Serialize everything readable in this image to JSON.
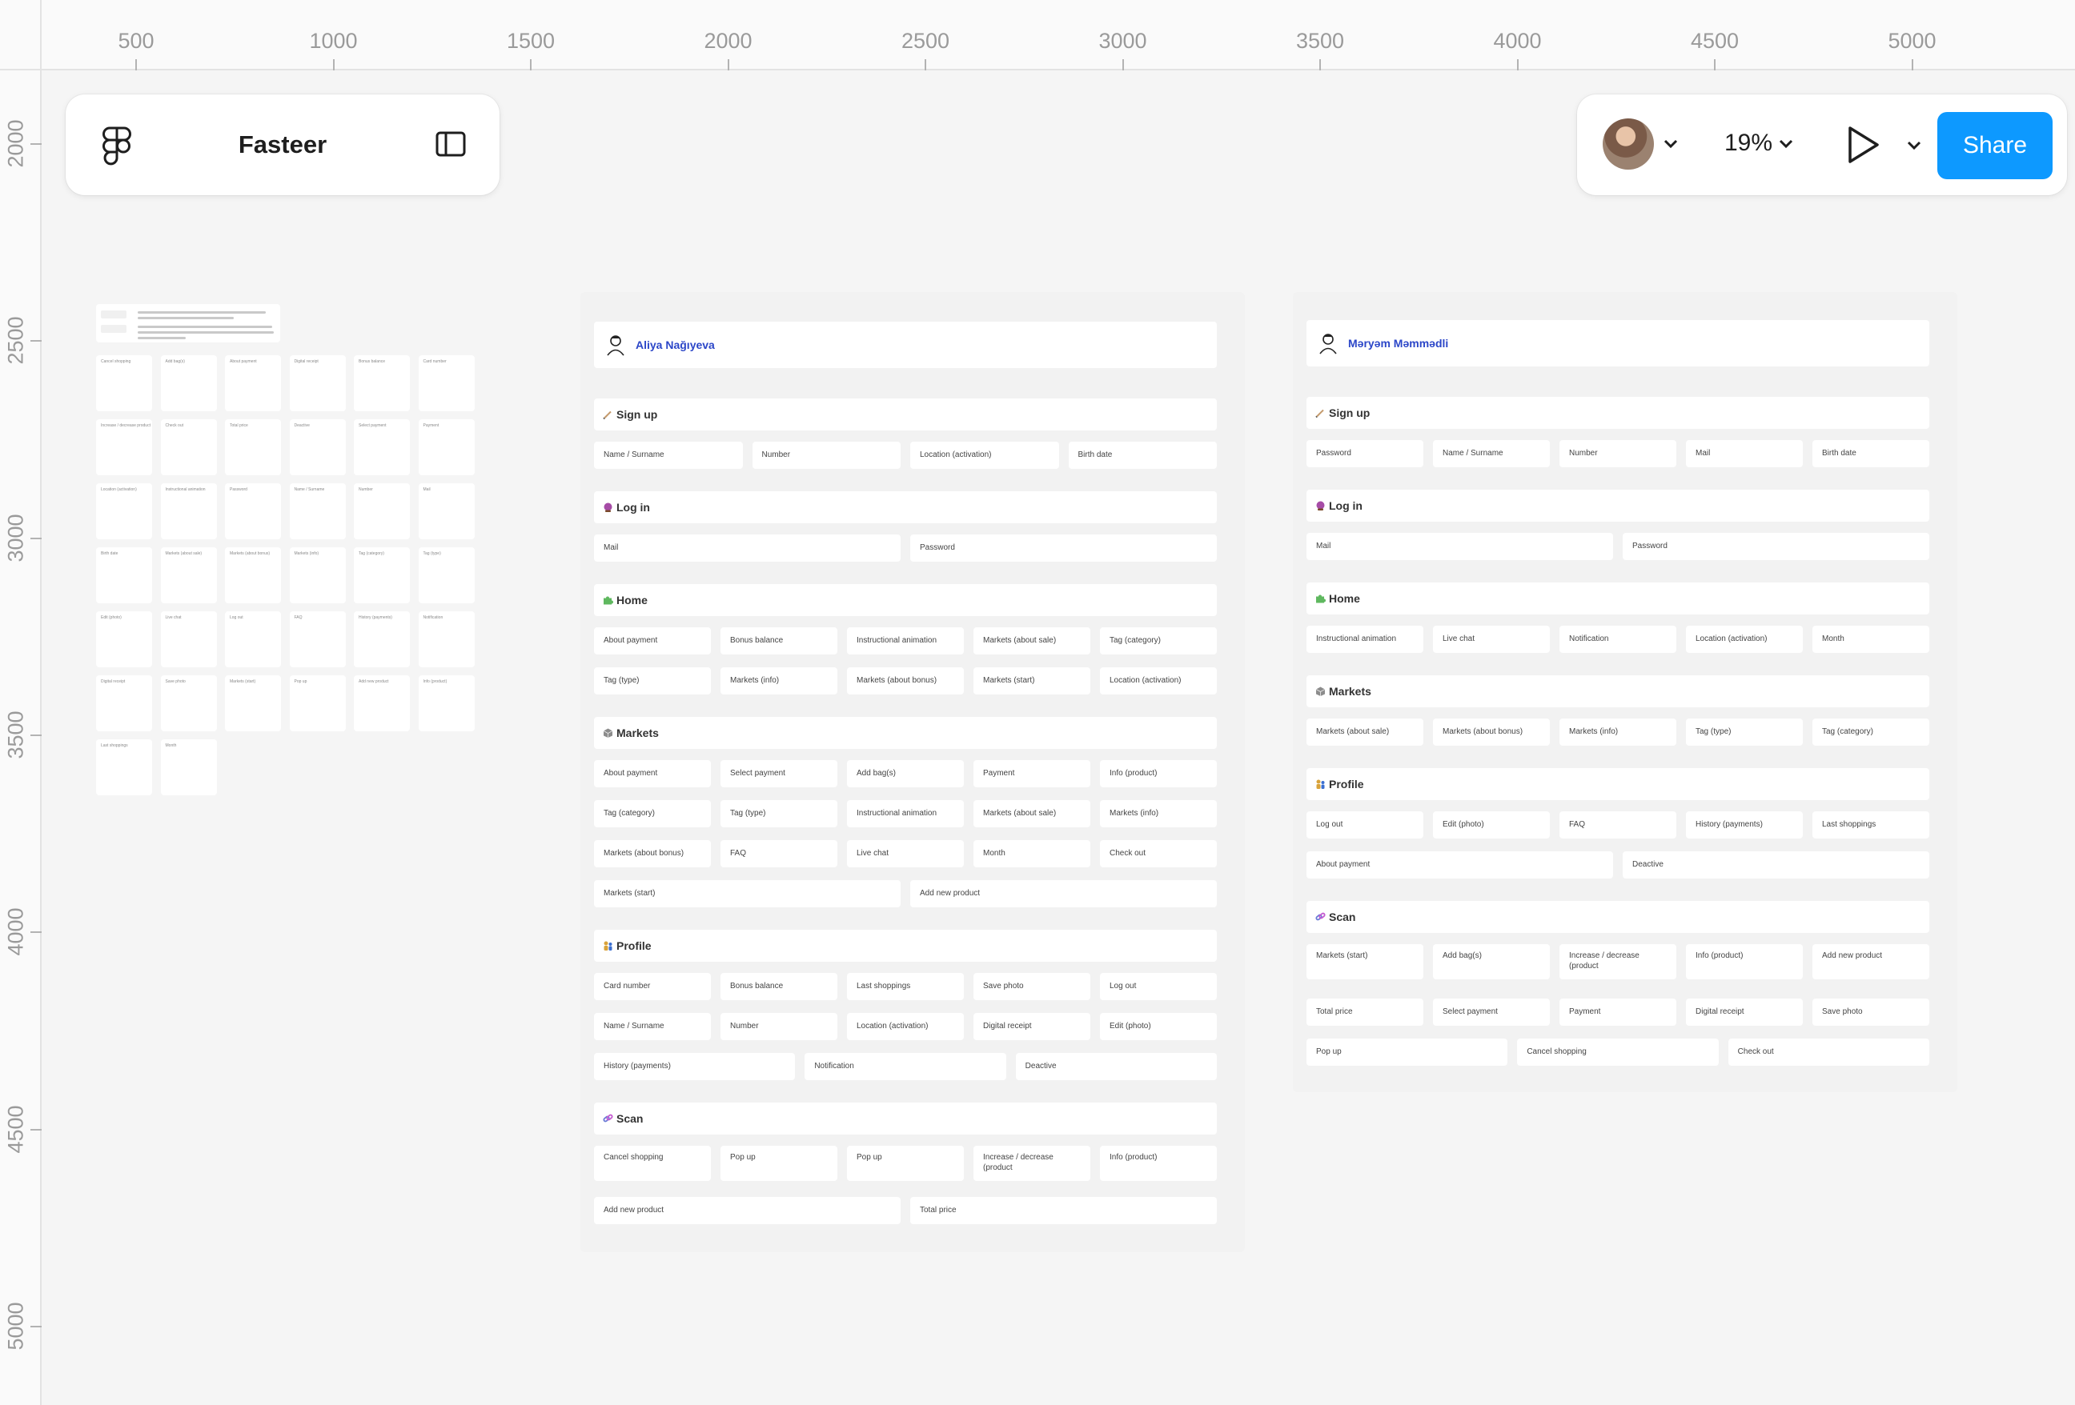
{
  "ruler": {
    "top_labels": [
      "500",
      "1000",
      "1500",
      "2000",
      "2500",
      "3000",
      "3500",
      "4000",
      "4500",
      "5000"
    ],
    "left_labels": [
      "2000",
      "2500",
      "3000",
      "3500",
      "4000",
      "4500",
      "5000"
    ]
  },
  "file_panel": {
    "title": "Fasteer",
    "logo_icon": "figma-logo-icon",
    "toggle_icon": "sidebar-toggle-icon"
  },
  "toolbar": {
    "zoom": "19%",
    "share_label": "Share",
    "play_icon": "play-icon",
    "colors": {
      "share": "#0d99ff"
    }
  },
  "mini_board": {
    "header_labels": [
      "Final plan",
      "Second Step"
    ],
    "cards": [
      "Cancel shopping",
      "Add bag(s)",
      "About payment",
      "Digital receipt",
      "Bonus balance",
      "Card number",
      "Increase / decrease product",
      "Check out",
      "Total price",
      "Deactive",
      "Select payment",
      "Payment",
      "Location (activation)",
      "Instructional animation",
      "Password",
      "Name / Surname",
      "Number",
      "Mail",
      "Birth date",
      "Markets (about sale)",
      "Markets (about bonus)",
      "Markets (info)",
      "Tag (category)",
      "Tag (type)",
      "Edit (photo)",
      "Live chat",
      "Log out",
      "FAQ",
      "History (payments)",
      "Notification",
      "Digital receipt",
      "Save photo",
      "Markets (start)",
      "Pop up",
      "Add new product",
      "Info (product)",
      "Last shoppings",
      "Month"
    ]
  },
  "frame_left": {
    "person": "Aliya Nağıyeva",
    "sections": [
      {
        "title": "Sign up",
        "rows": [
          [
            "Name / Surname",
            "Number",
            "Location (activation)",
            "Birth date"
          ]
        ]
      },
      {
        "title": "Log in",
        "rows": [
          [
            "Mail",
            "Password"
          ]
        ]
      },
      {
        "title": "Home",
        "rows": [
          [
            "About payment",
            "Bonus balance",
            "Instructional animation",
            "Markets (about sale)",
            "Tag (category)"
          ],
          [
            "Tag (type)",
            "Markets (info)",
            "Markets (about bonus)",
            "Markets (start)",
            "Location (activation)"
          ]
        ]
      },
      {
        "title": "Markets",
        "rows": [
          [
            "About payment",
            "Select payment",
            "Add bag(s)",
            "Payment",
            "Info (product)"
          ],
          [
            "Tag (category)",
            "Tag (type)",
            "Instructional animation",
            "Markets (about sale)",
            "Markets (info)"
          ],
          [
            "Markets (about bonus)",
            "FAQ",
            "Live chat",
            "Month",
            "Check out"
          ],
          [
            "Markets (start)",
            "Add new product"
          ]
        ]
      },
      {
        "title": "Profile",
        "rows": [
          [
            "Card number",
            "Bonus balance",
            "Last shoppings",
            "Save photo",
            "Log out"
          ],
          [
            "Name / Surname",
            "Number",
            "Location (activation)",
            "Digital receipt",
            "Edit (photo)"
          ],
          [
            "History (payments)",
            "Notification",
            "Deactive"
          ]
        ]
      },
      {
        "title": "Scan",
        "rows": [
          [
            "Cancel shopping",
            "Pop up",
            "Pop up",
            "Increase / decrease (product",
            "Info (product)"
          ],
          [
            "Add new product",
            "Total price"
          ]
        ]
      }
    ]
  },
  "frame_right": {
    "person": "Məryəm Məmmədli",
    "sections": [
      {
        "title": "Sign up",
        "rows": [
          [
            "Password",
            "Name / Surname",
            "Number",
            "Mail",
            "Birth date"
          ]
        ]
      },
      {
        "title": "Log in",
        "rows": [
          [
            "Mail",
            "Password"
          ]
        ]
      },
      {
        "title": "Home",
        "rows": [
          [
            "Instructional animation",
            "Live chat",
            "Notification",
            "Location (activation)",
            "Month"
          ]
        ]
      },
      {
        "title": "Markets",
        "rows": [
          [
            "Markets (about sale)",
            "Markets (about bonus)",
            "Markets (info)",
            "Tag (type)",
            "Tag (category)"
          ]
        ]
      },
      {
        "title": "Profile",
        "rows": [
          [
            "Log out",
            "Edit (photo)",
            "FAQ",
            "History (payments)",
            "Last shoppings"
          ],
          [
            "About payment",
            "Deactive"
          ]
        ]
      },
      {
        "title": "Scan",
        "rows": [
          [
            "Markets (start)",
            "Add bag(s)",
            "Increase / decrease (product",
            "Info (product)",
            "Add new product"
          ],
          [
            "Total price",
            "Select payment",
            "Payment",
            "Digital receipt",
            "Save photo"
          ],
          [
            "Pop up",
            "Cancel shopping",
            "Check out"
          ]
        ]
      }
    ]
  },
  "section_icon_colors": {
    "Sign up": "#c49a6c",
    "Log in": "#a64ca6",
    "Home": "#5fb85f",
    "Markets": "#8c8c8c",
    "Profile": "#d9a33a",
    "Scan": "#6b7bd6"
  }
}
